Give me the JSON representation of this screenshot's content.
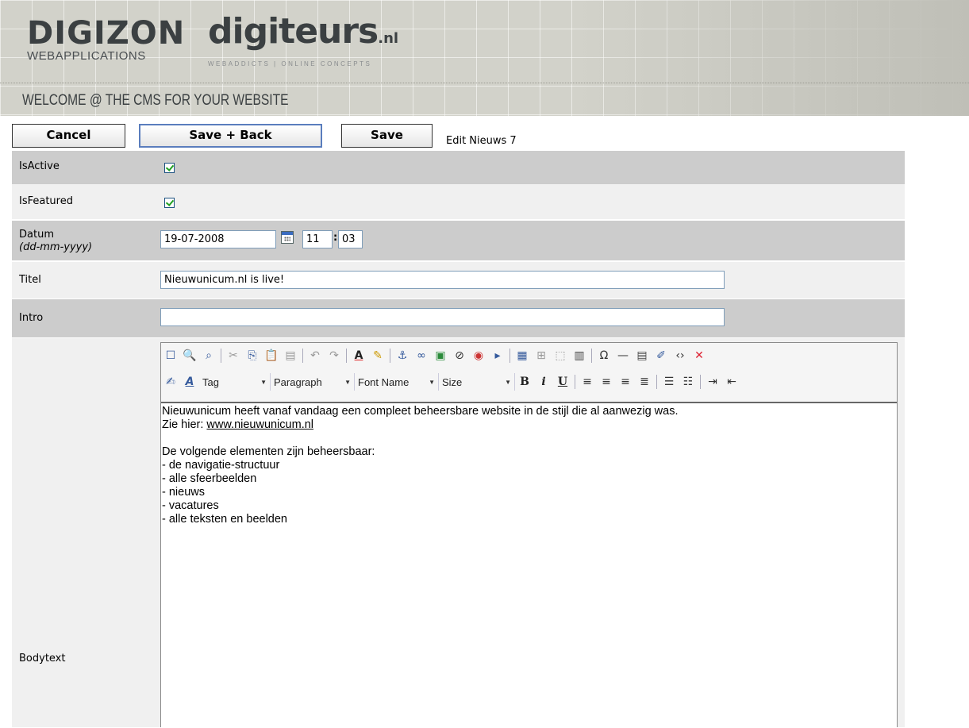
{
  "header": {
    "logo_primary": "DIGIZON",
    "logo_primary_sub": "WEBAPPLICATIONS",
    "logo_secondary": "digiteurs",
    "logo_secondary_tld": ".nl",
    "logo_secondary_tagline": "WEBADDICTS | ONLINE CONCEPTS",
    "welcome": "WELCOME @ THE CMS FOR YOUR WEBSITE"
  },
  "toolbar": {
    "cancel_label": "Cancel",
    "save_back_label": "Save + Back",
    "save_label": "Save",
    "page_title": "Edit Nieuws 7"
  },
  "form": {
    "isactive": {
      "label": "IsActive",
      "checked": true
    },
    "isfeatured": {
      "label": "IsFeatured",
      "checked": true
    },
    "datum": {
      "label": "Datum",
      "hint": "(dd-mm-yyyy)",
      "date": "19-07-2008",
      "hour": "11",
      "minute": "03"
    },
    "titel": {
      "label": "Titel",
      "value": "Nieuwunicum.nl is live!"
    },
    "intro": {
      "label": "Intro",
      "value": ""
    },
    "bodytext": {
      "label": "Bodytext"
    }
  },
  "editor": {
    "dropdowns": {
      "tag": "Tag",
      "paragraph": "Paragraph",
      "font_name": "Font Name",
      "size": "Size"
    },
    "content": {
      "line1": "Nieuwunicum heeft vanaf vandaag een compleet beheersbare website in de stijl die al aanwezig was.",
      "line2_prefix": "Zie hier: ",
      "line2_link": "www.nieuwunicum.nl",
      "line3": "De volgende elementen zijn beheersbaar:",
      "items": [
        "- de navigatie-structuur",
        "- alle sfeerbeelden",
        "- nieuws",
        "- vacatures",
        "- alle teksten en beelden"
      ]
    }
  }
}
